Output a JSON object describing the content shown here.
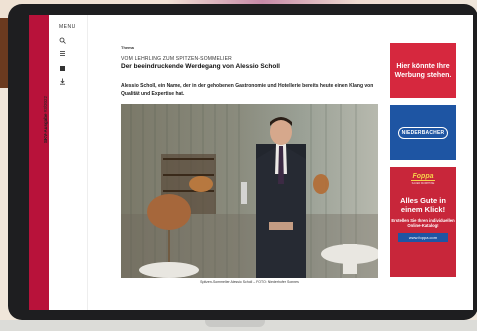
{
  "sidebar": {
    "menu_label": "MENU",
    "publication_name": "SKV-Ausgabe",
    "issue": "#3/2022",
    "icons": [
      "search-icon",
      "list-icon",
      "book-icon",
      "download-icon"
    ]
  },
  "article": {
    "kicker": "Thema",
    "overline": "VOM LEHRLING ZUM SPITZEN-SOMMELIER",
    "headline": "Der beeindruckende Werdegang von Alessio Scholl",
    "lead": "Alessio Scholl, ein Name, der in der gehobenen Gastronomie und Hotellerie bereits heute einen Klang von Qualität und Expertise hat.",
    "photo_caption": "Spitzen-Sommelier Alessio Scholl – FOTO: Niederhofer Sonnes"
  },
  "ads": {
    "ad1_text": "Hier könnte Ihre Werbung stehen.",
    "ad2_logo": "NIEDERBACHER",
    "ad3": {
      "brand": "Foppa",
      "subline": "SAUER MURPHINE",
      "title": "Alles Gute in einem Klick!",
      "text": "Erstellen Sie Ihren individuellen Online-Katalog!",
      "url": "www.foppa.com"
    }
  },
  "colors": {
    "accent_red": "#b8123a",
    "ad_red": "#d6283e",
    "ad_blue": "#1e55a3",
    "device_frame": "#1e1e20"
  }
}
